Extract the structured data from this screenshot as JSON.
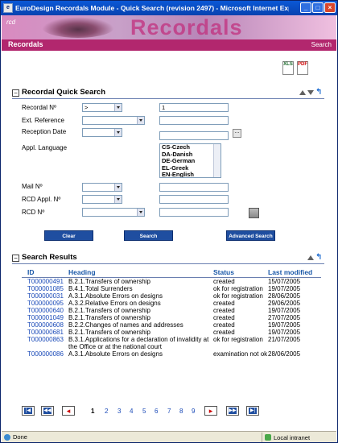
{
  "window": {
    "title": "EuroDesign Recordals Module - Quick Search (revision 2497) - Microsoft Internet Explorer..."
  },
  "banner": {
    "logo": "rcd",
    "brand": "Recordals"
  },
  "subbar": {
    "left": "Recordals",
    "right": "Search"
  },
  "export": {
    "xls": "XLS",
    "pdf": "PDF"
  },
  "quick_search": {
    "title": "Recordal Quick Search",
    "fields": {
      "recordal_no": {
        "label": "Recordal Nº",
        "operator": ">",
        "value": "1"
      },
      "ext_reference": {
        "label": "Ext. Reference",
        "value": "",
        "text": ""
      },
      "reception_date": {
        "label": "Reception Date",
        "value": "",
        "text": "",
        "picker": "..."
      },
      "appl_language": {
        "label": "Appl. Language",
        "options": [
          "CS-Czech",
          "DA-Danish",
          "DE-German",
          "EL-Greek",
          "EN-English"
        ]
      },
      "mail_no": {
        "label": "Mail Nº",
        "value": "",
        "text": ""
      },
      "rcd_appl_no": {
        "label": "RCD Appl. Nº",
        "value": "",
        "text": ""
      },
      "rcd_no": {
        "label": "RCD Nº",
        "value": "",
        "text": ""
      }
    },
    "buttons": {
      "clear": "Clear",
      "search": "Search",
      "advanced": "Advanced Search"
    }
  },
  "results": {
    "title": "Search Results",
    "columns": {
      "id": "ID",
      "heading": "Heading",
      "status": "Status",
      "last_modified": "Last modified"
    },
    "rows": [
      {
        "id": "T000000491",
        "heading": "B.2.1.Transfers of ownership",
        "status": "created",
        "modified": "15/07/2005"
      },
      {
        "id": "T000001085",
        "heading": "B.4.1.Total Surrenders",
        "status": "ok for registration",
        "modified": "19/07/2005"
      },
      {
        "id": "T000000031",
        "heading": "A.3.1.Absolute Errors on designs",
        "status": "ok for registration",
        "modified": "28/06/2005"
      },
      {
        "id": "T000000095",
        "heading": "A.3.2.Relative Errors on designs",
        "status": "created",
        "modified": "29/06/2005"
      },
      {
        "id": "T000000640",
        "heading": "B.2.1.Transfers of ownership",
        "status": "created",
        "modified": "19/07/2005"
      },
      {
        "id": "T000001049",
        "heading": "B.2.1.Transfers of ownership",
        "status": "created",
        "modified": "27/07/2005"
      },
      {
        "id": "T000000608",
        "heading": "B.2.2.Changes of names and addresses",
        "status": "created",
        "modified": "19/07/2005"
      },
      {
        "id": "T000000681",
        "heading": "B.2.1.Transfers of ownership",
        "status": "created",
        "modified": "19/07/2005"
      },
      {
        "id": "T000000863",
        "heading": "B.3.1.Applications for a declaration of invalidity at the Office or at the national court",
        "status": "ok for registration",
        "modified": "21/07/2005"
      },
      {
        "id": "T000000086",
        "heading": "A.3.1.Absolute Errors on designs",
        "status": "examination not ok",
        "modified": "28/06/2005"
      }
    ],
    "pager": {
      "pages": [
        "1",
        "2",
        "3",
        "4",
        "5",
        "6",
        "7",
        "8",
        "9"
      ],
      "current": "1"
    }
  },
  "statusbar": {
    "text": "Done",
    "zone": "Local intranet"
  }
}
